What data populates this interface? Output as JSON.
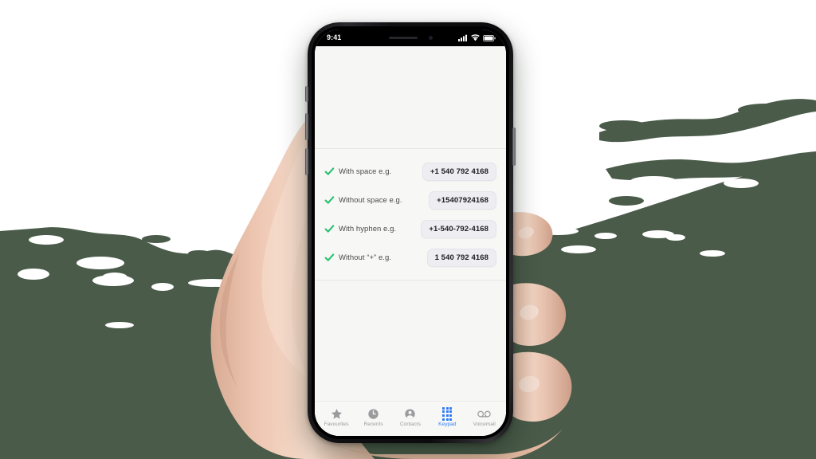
{
  "background": {
    "base_color": "#ffffff",
    "paint_color": "#4a5b4a",
    "description": "white background with dark-green organic paint shape across lower half"
  },
  "device": {
    "frame_color": "#111114",
    "screen_background": "#f6f6f5",
    "buttons": {
      "mute_switch": "mute-switch",
      "volume_up": "volume-up-button",
      "volume_down": "volume-down-button",
      "power": "power-button"
    }
  },
  "status_bar": {
    "time": "9:41",
    "icons": [
      "signal-icon",
      "wifi-icon",
      "battery-icon"
    ]
  },
  "list": {
    "rows": [
      {
        "check_icon": "green-check-icon",
        "label": "With space e.g.",
        "value": "+1 540 792 4168"
      },
      {
        "check_icon": "green-check-icon",
        "label": "Without space e.g.",
        "value": "+15407924168"
      },
      {
        "check_icon": "green-check-icon",
        "label": "With hyphen e.g.",
        "value": "+1-540-792-4168"
      },
      {
        "check_icon": "green-check-icon",
        "label": "Without “+” e.g.",
        "value": "1 540 792 4168"
      }
    ],
    "check_color": "#25c26e",
    "chip_background": "#eeedf2",
    "chip_text_color": "#1d1d1f"
  },
  "tab_bar": {
    "active_color": "#2f7bf6",
    "inactive_color": "#9b9b9e",
    "tabs": [
      {
        "label": "Favourites",
        "icon": "star-icon",
        "active": false
      },
      {
        "label": "Recents",
        "icon": "clock-icon",
        "active": false
      },
      {
        "label": "Contacts",
        "icon": "person-icon",
        "active": false
      },
      {
        "label": "Keypad",
        "icon": "keypad-icon",
        "active": true
      },
      {
        "label": "Voicemail",
        "icon": "voicemail-icon",
        "active": false
      }
    ]
  }
}
